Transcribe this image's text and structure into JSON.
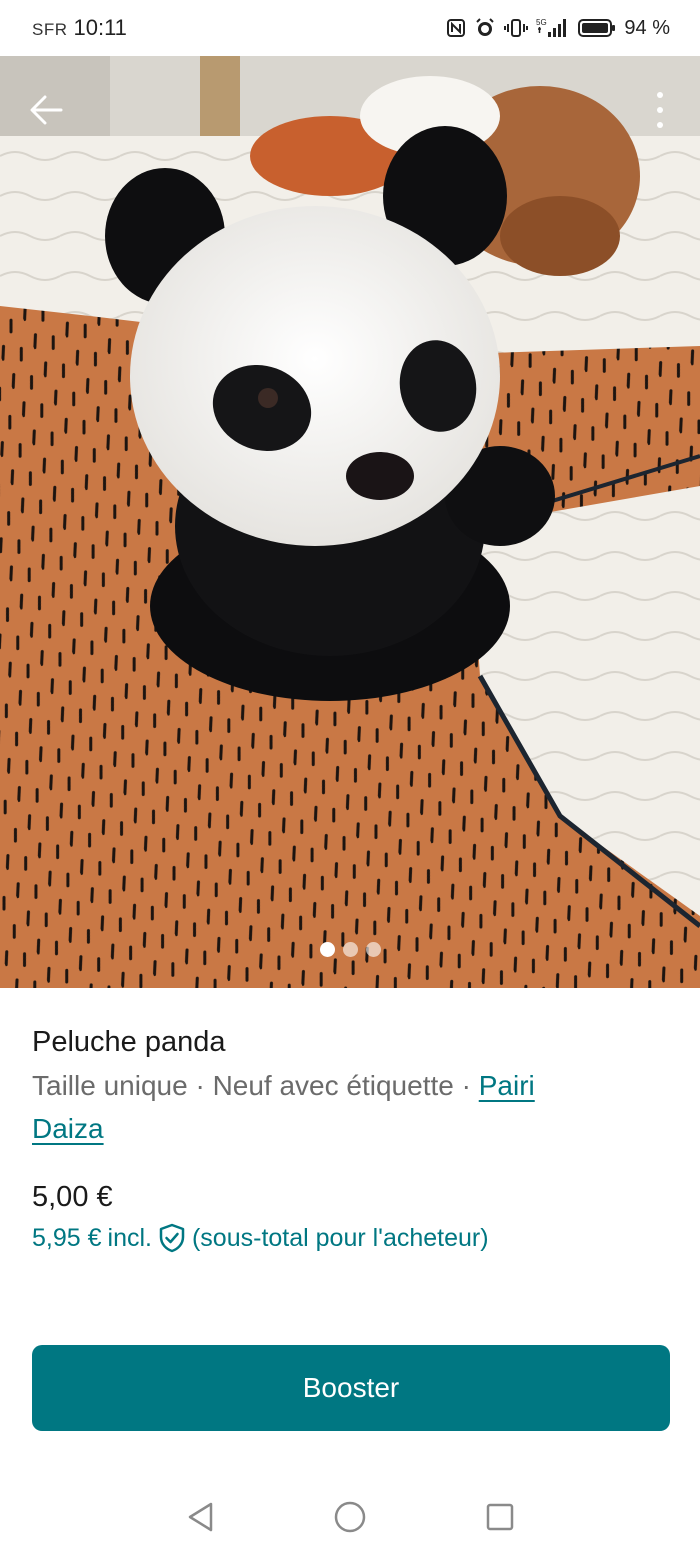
{
  "status_bar": {
    "carrier": "SFR",
    "time": "10:11",
    "network": "5G",
    "battery": "94 %"
  },
  "photo": {
    "image_count": 3,
    "active_index": 0,
    "icons": [
      "back-arrow-icon",
      "more-vertical-icon"
    ]
  },
  "listing": {
    "title": "Peluche panda",
    "size": "Taille unique",
    "separator": "·",
    "condition": "Neuf avec étiquette",
    "brand_line1": "Pairi",
    "brand_line2": "Daiza",
    "price": "5,00 €",
    "buyer_price": "5,95 €",
    "incl": "incl.",
    "buyer_note": "(sous-total pour l'acheteur)"
  },
  "actions": {
    "booster_label": "Booster"
  },
  "colors": {
    "accent": "#007782",
    "text_primary": "#1a1a1a",
    "text_secondary": "#6b6b6b"
  }
}
